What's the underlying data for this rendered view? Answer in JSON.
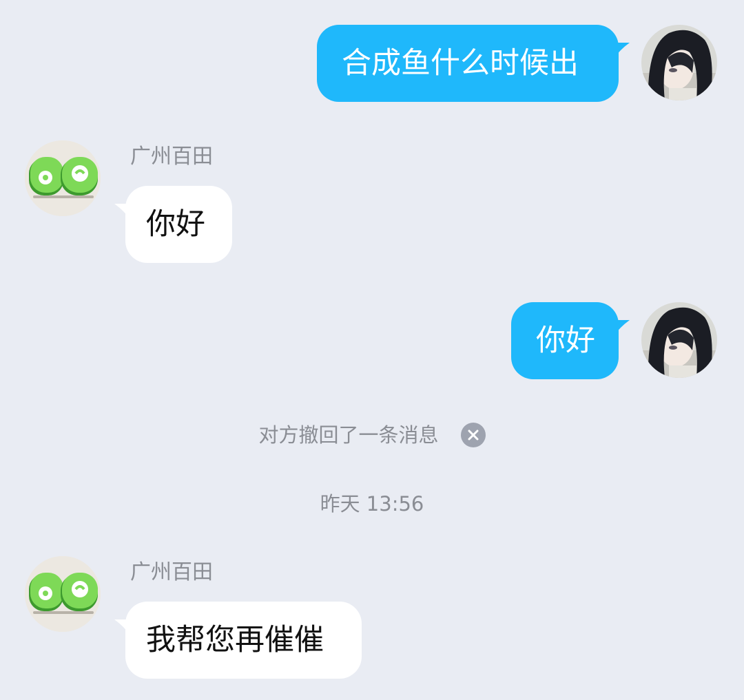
{
  "messages": [
    {
      "direction": "out",
      "text": "合成鱼什么时候出"
    },
    {
      "direction": "in",
      "sender": "广州百田",
      "text": "你好"
    },
    {
      "direction": "out",
      "text": "你好"
    },
    {
      "direction": "in",
      "sender": "广州百田",
      "text": "我帮您再催催"
    }
  ],
  "system": {
    "recall_notice": "对方撤回了一条消息",
    "close_icon": "close-icon",
    "timestamp": "昨天 13:56"
  },
  "colors": {
    "background": "#e9ecf3",
    "outgoing_bubble": "#1fb8fb",
    "incoming_bubble": "#ffffff",
    "muted_text": "#8a8d94"
  }
}
